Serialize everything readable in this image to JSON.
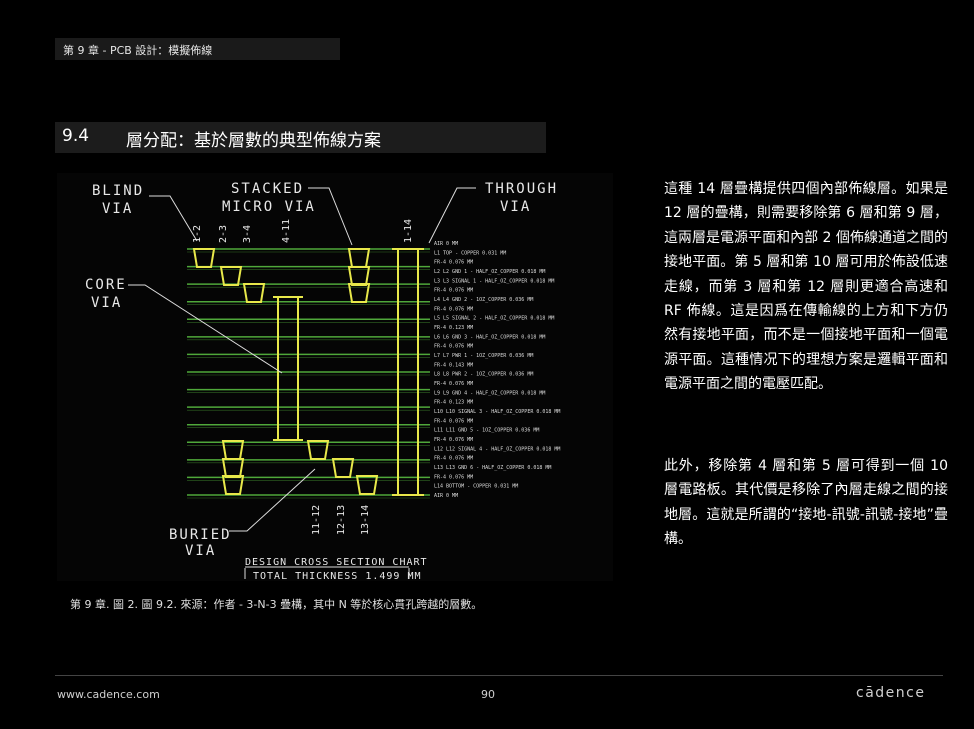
{
  "header": {
    "chapter_text": "第 9 章 - PCB 設計：模擬佈線"
  },
  "section": {
    "number": "9.4",
    "title": "層分配：基於層數的典型佈線方案"
  },
  "figure": {
    "labels": {
      "blind_via_1": "BLIND",
      "blind_via_2": "VIA",
      "stacked_1": "STACKED",
      "stacked_2": "MICRO VIA",
      "through_1": "THROUGH",
      "through_2": "VIA",
      "core_1": "CORE",
      "core_2": "VIA",
      "buried_1": "BURIED",
      "buried_2": "VIA",
      "chart_title": "DESIGN CROSS SECTION CHART",
      "total_thickness": "TOTAL THICKNESS 1.499 MM"
    },
    "top_spans": [
      "1-2",
      "2-3",
      "3-4",
      "4-11",
      "1-14"
    ],
    "bottom_spans": [
      "11-12",
      "12-13",
      "13-14"
    ],
    "stackup": [
      "AIR 0 MM",
      "L1 TOP - COPPER 0.031 MM",
      "FR-4 0.076 MM",
      "L2 L2 GND 1 - HALF_OZ_COPPER 0.018 MM",
      "L3 L3 SIGNAL 1 - HALF_OZ_COPPER 0.018 MM",
      "FR-4 0.076 MM",
      "L4 L4 GND 2 - 1OZ_COPPER 0.036 MM",
      "FR-4 0.076 MM",
      "L5 L5 SIGNAL 2 - HALF_OZ_COPPER 0.018 MM",
      "FR-4 0.123 MM",
      "L6 L6 GND 3 - HALF_OZ_COPPER 0.018 MM",
      "FR-4 0.076 MM",
      "L7 L7 PWR 1 - 1OZ_COPPER 0.036 MM",
      "FR-4 0.143 MM",
      "L8 L8 PWR 2 - 1OZ_COPPER 0.036 MM",
      "FR-4 0.076 MM",
      "L9 L9 GND 4 - HALF_OZ_COPPER 0.018 MM",
      "FR-4 0.123 MM",
      "L10 L10 SIGNAL 3 - HALF_OZ_COPPER 0.018 MM",
      "FR-4 0.076 MM",
      "L11 L11 GND 5 - 1OZ_COPPER 0.036 MM",
      "FR-4 0.076 MM",
      "L12 L12 SIGNAL 4 - HALF_OZ_COPPER 0.018 MM",
      "FR-4 0.076 MM",
      "L13 L13 GND 6 - HALF_OZ_COPPER 0.018 MM",
      "FR-4 0.076 MM",
      "L14 BOTTOM - COPPER 0.031 MM",
      "AIR 0 MM"
    ]
  },
  "caption": "第 9 章. 圖 2. 圖 9.2. 來源：作者 -  3-N-3 疊構，其中 N 等於核心貫孔跨越的層數。",
  "body": {
    "p1": "這種 14 層疊構提供四個內部佈線層。如果是 12 層的疊構，則需要移除第 6 層和第 9 層，這兩層是電源平面和內部 2 個佈線通道之間的接地平面。第 5 層和第 10 層可用於佈設低速走線，而第 3 層和第 12 層則更適合高速和 RF 佈線。這是因爲在傳輸線的上方和下方仍然有接地平面，而不是一個接地平面和一個電源平面。這種情况下的理想方案是邏輯平面和電源平面之間的電壓匹配。",
    "p2": "此外，移除第 4 層和第 5 層可得到一個 10 層電路板。其代價是移除了內層走線之間的接地層。這就是所謂的“接地-訊號-訊號-接地”疊構。"
  },
  "footer": {
    "url": "www.cadence.com",
    "page": "90",
    "logo": "cādence"
  },
  "colors": {
    "via": "#e8e84a",
    "layer_line": "#4fa83a",
    "text": "#ffffff",
    "figure_bg": "#050505"
  }
}
